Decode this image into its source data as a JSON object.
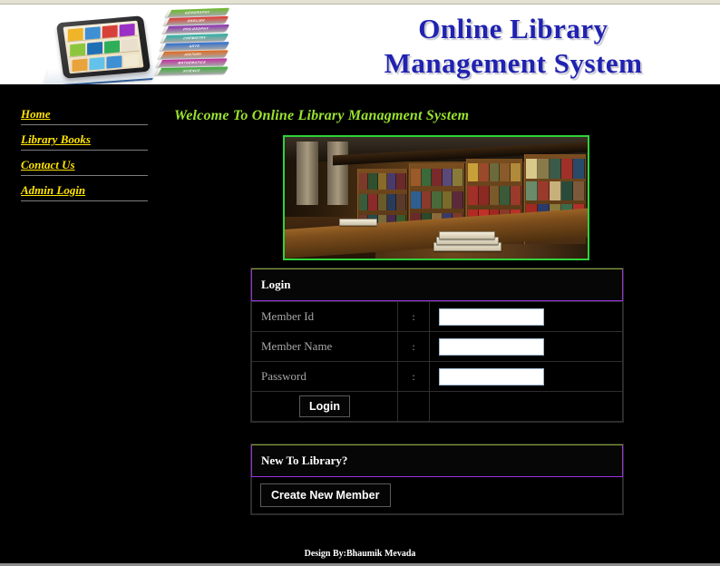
{
  "header": {
    "title_line1": "Online Library",
    "title_line2": "Management System",
    "title_color": "#2022b0",
    "logo_books": [
      {
        "label": "GEOGRAPHY",
        "color": "#6cb92c"
      },
      {
        "label": "ENGLISH",
        "color": "#e03a2f"
      },
      {
        "label": "PHILOSOPHY",
        "color": "#8e2fb0"
      },
      {
        "label": "CHEMISTRY",
        "color": "#2fb0a6"
      },
      {
        "label": "ARTS",
        "color": "#2f6fd0"
      },
      {
        "label": "HISTORY",
        "color": "#e06a1f"
      },
      {
        "label": "MATHEMATICS",
        "color": "#c22fa0"
      },
      {
        "label": "SCIENCE",
        "color": "#3fae3a"
      }
    ]
  },
  "sidebar": {
    "items": [
      {
        "label": "Home",
        "name": "sidebar-item-home"
      },
      {
        "label": "Library Books",
        "name": "sidebar-item-library-books"
      },
      {
        "label": "Contact Us",
        "name": "sidebar-item-contact-us"
      },
      {
        "label": "Admin Login",
        "name": "sidebar-item-admin-login"
      }
    ],
    "link_color": "#ffe400"
  },
  "main": {
    "welcome": "Welcome To Online Library Managment System",
    "welcome_color": "#9ae32e",
    "hero_image_alt": "library-interior-photo",
    "hero_border_color": "#2fd23a"
  },
  "login_panel": {
    "heading": "Login",
    "accent_color": "#9b30e0",
    "top_accent_color": "#86a62c",
    "rows": [
      {
        "label": "Member Id",
        "separator": ":",
        "value": "",
        "placeholder": "",
        "input_name": "member-id-input",
        "type": "text"
      },
      {
        "label": "Member Name",
        "separator": ":",
        "value": "",
        "placeholder": "",
        "input_name": "member-name-input",
        "type": "text"
      },
      {
        "label": "Password",
        "separator": ":",
        "value": "",
        "placeholder": "",
        "input_name": "password-input",
        "type": "password"
      }
    ],
    "submit_label": "Login"
  },
  "new_member_panel": {
    "heading": "New To Library?",
    "button_label": "Create New Member"
  },
  "footer": {
    "text": "Design By:Bhaumik Mevada"
  }
}
